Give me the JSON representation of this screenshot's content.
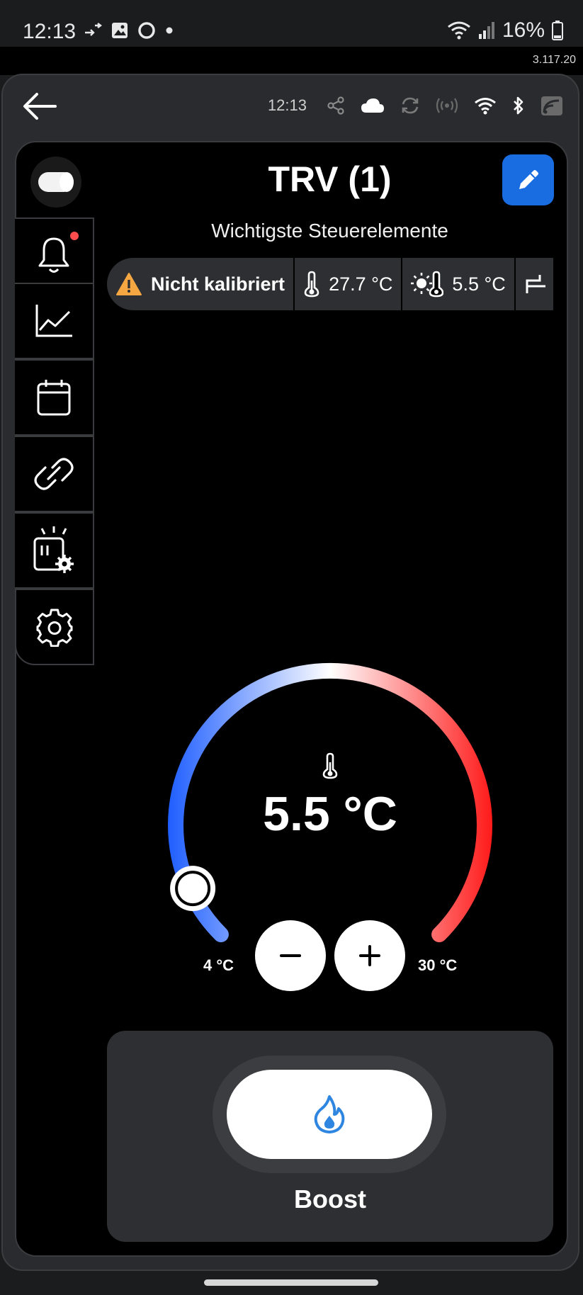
{
  "status_bar": {
    "time": "12:13",
    "battery": "16%",
    "icons": [
      "call-forward-icon",
      "image-icon",
      "circle-icon",
      "dot-icon",
      "wifi-icon",
      "signal-icon",
      "battery-icon"
    ]
  },
  "version": "3.117.20",
  "toolbar": {
    "time": "12:13",
    "icons": [
      "share-icon",
      "cloud-icon",
      "sync-icon",
      "broadcast-icon",
      "wifi-icon",
      "bluetooth-icon",
      "rss-icon"
    ]
  },
  "sidebar": {
    "items": [
      {
        "name": "notifications",
        "icon": "bell-icon",
        "has_badge": true
      },
      {
        "name": "history",
        "icon": "chart-icon"
      },
      {
        "name": "schedule",
        "icon": "calendar-icon"
      },
      {
        "name": "links",
        "icon": "link-icon"
      },
      {
        "name": "device-settings",
        "icon": "device-gear-icon"
      },
      {
        "name": "settings",
        "icon": "gear-icon"
      }
    ]
  },
  "device": {
    "title": "TRV (1)",
    "subtitle": "Wichtigste Steuerelemente"
  },
  "chips": [
    {
      "icon": "warning-icon",
      "text": "Nicht kalibriert"
    },
    {
      "icon": "thermometer-icon",
      "text": "27.7 °C"
    },
    {
      "icon": "sun-thermometer-icon",
      "text": "5.5 °C"
    }
  ],
  "thermostat": {
    "value": "5.5 °C",
    "min_label": "4 °C",
    "max_label": "30 °C",
    "min": 4,
    "max": 30,
    "setpoint": 5.5
  },
  "boost": {
    "label": "Boost",
    "icon": "flame-icon"
  },
  "colors": {
    "accent_blue": "#1a6de0",
    "dial_cold": "#1f5eff",
    "dial_hot": "#ff1a1a",
    "badge_red": "#ff4d4d",
    "warning": "#f5a742"
  }
}
